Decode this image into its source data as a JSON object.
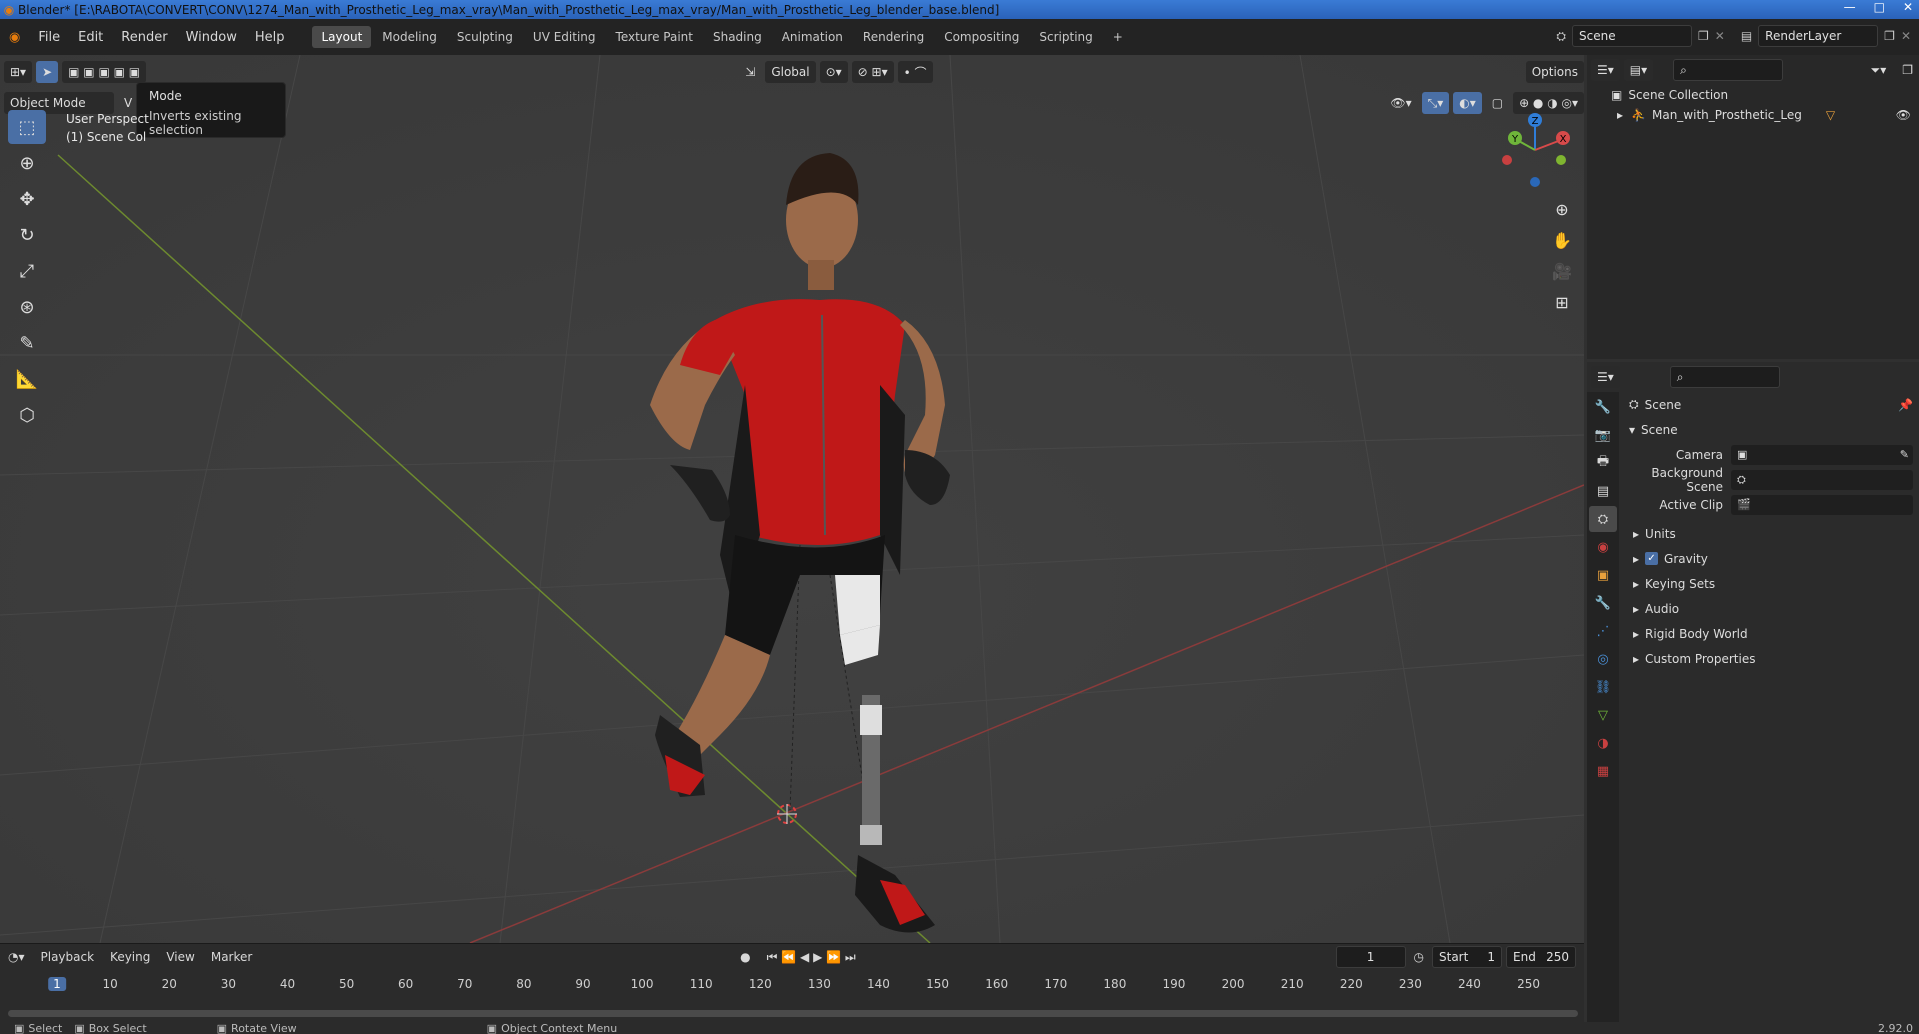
{
  "titlebar": {
    "title": "Blender* [E:\\RABOTA\\CONVERT\\CONV\\1274_Man_with_Prosthetic_Leg_max_vray\\Man_with_Prosthetic_Leg_max_vray/Man_with_Prosthetic_Leg_blender_base.blend]",
    "minimize": "—",
    "maximize": "□",
    "close": "✕"
  },
  "menubar": {
    "items": [
      "File",
      "Edit",
      "Render",
      "Window",
      "Help"
    ],
    "workspaces": [
      "Layout",
      "Modeling",
      "Sculpting",
      "UV Editing",
      "Texture Paint",
      "Shading",
      "Animation",
      "Rendering",
      "Compositing",
      "Scripting"
    ],
    "active_workspace": "Layout",
    "add_tab": "+",
    "scene": "Scene",
    "render_layer": "RenderLayer"
  },
  "viewport": {
    "mode": "Object Mode",
    "mode_menu_short": "V",
    "transform_orientation": "Global",
    "options": "Options",
    "perspective_label": "User Perspect",
    "collection_label": "(1) Scene Col",
    "tooltip": {
      "title": "Mode",
      "description": "Inverts existing selection"
    },
    "gizmo": {
      "x": "X",
      "y": "Y",
      "z": "Z"
    },
    "colors": {
      "bg": "#3d3d3d",
      "grid": "#474747",
      "x_axis": "#8a3b3b",
      "y_axis": "#6d8a2f",
      "accent": "#4a6fa5"
    }
  },
  "timeline": {
    "menus": [
      "Playback",
      "Keying",
      "View",
      "Marker"
    ],
    "current_frame": "1",
    "start_label": "Start",
    "start": "1",
    "end_label": "End",
    "end": "250",
    "ticks": [
      "1",
      "10",
      "20",
      "30",
      "40",
      "50",
      "60",
      "70",
      "80",
      "90",
      "100",
      "110",
      "120",
      "130",
      "140",
      "150",
      "160",
      "170",
      "180",
      "190",
      "200",
      "210",
      "220",
      "230",
      "240",
      "250"
    ]
  },
  "statusbar": {
    "select": "Select",
    "box_select": "Box Select",
    "rotate_view": "Rotate View",
    "context_menu": "Object Context Menu",
    "version": "2.92.0"
  },
  "outliner": {
    "root": "Scene Collection",
    "items": [
      {
        "name": "Man_with_Prosthetic_Leg"
      }
    ]
  },
  "properties": {
    "header": "Scene",
    "section": "Scene",
    "fields": [
      {
        "label": "Camera",
        "value": ""
      },
      {
        "label": "Background Scene",
        "value": ""
      },
      {
        "label": "Active Clip",
        "value": ""
      }
    ],
    "panels": [
      {
        "name": "Units",
        "checkbox": false
      },
      {
        "name": "Gravity",
        "checkbox": true
      },
      {
        "name": "Keying Sets",
        "checkbox": false
      },
      {
        "name": "Audio",
        "checkbox": false
      },
      {
        "name": "Rigid Body World",
        "checkbox": false
      },
      {
        "name": "Custom Properties",
        "checkbox": false
      }
    ]
  }
}
